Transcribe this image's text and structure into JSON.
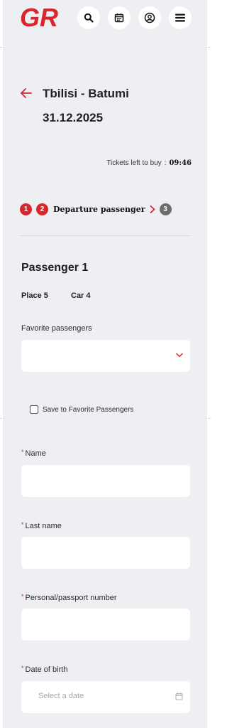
{
  "header": {
    "logo_text": "GR",
    "brand_color": "#d8262c",
    "icons": [
      "search-icon",
      "calendar-icon",
      "user-icon",
      "menu-icon"
    ]
  },
  "trip": {
    "route": "Tbilisi - Batumi",
    "date": "31.12.2025"
  },
  "timer": {
    "label": "Tickets left to buy",
    "separator": ":",
    "time": "09:46"
  },
  "steps": {
    "step1": "1",
    "step2": "2",
    "step2_label": "Departure passenger",
    "step3": "3"
  },
  "passenger": {
    "title": "Passenger 1",
    "place": "Place 5",
    "car": "Car 4"
  },
  "favorites": {
    "label": "Favorite passengers",
    "value": "",
    "save_label": "Save to Favorite Passengers",
    "save_checked": false
  },
  "form": {
    "required_mark": "*",
    "name_label": "Name",
    "last_name_label": "Last name",
    "passport_label": "Personal/passport number",
    "dob_label": "Date of birth",
    "dob_placeholder": "Select a date"
  }
}
